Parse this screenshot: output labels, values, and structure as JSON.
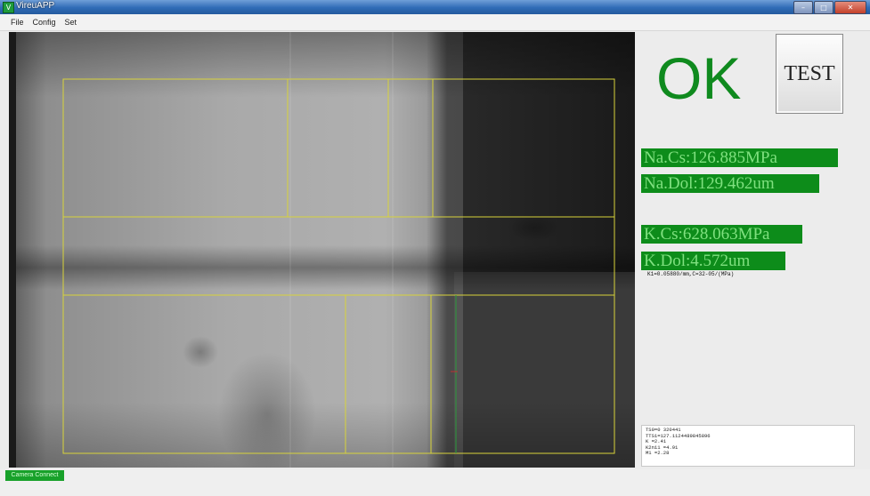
{
  "window": {
    "title": "VireuAPP",
    "icon": "app-icon"
  },
  "menu": {
    "items": [
      "File",
      "Config",
      "Set"
    ]
  },
  "result": {
    "status": "OK",
    "status_color": "#0f8a1e"
  },
  "test_button": {
    "label": "TEST"
  },
  "measurements": {
    "na_cs": "Na.Cs:126.885MPa",
    "na_dol": "Na.Dol:129.462um",
    "k_cs": "K.Cs:628.063MPa",
    "k_dol": "K.Dol:4.572um",
    "background_color": "#0d8c1a",
    "text_color": "#7fe07f"
  },
  "constants_note": "K1=0.05880/mm,C=32-05/(MPa)",
  "log": {
    "lines": [
      "TS0=0 320441",
      "TTS1=127.1124489845896",
      "K =2.41",
      "K2n11 =4.91",
      "M1 =2.28"
    ]
  },
  "status_bar": {
    "badge": "Camera Connect",
    "badge_color": "#18a12a"
  },
  "overlay": {
    "line_color": "#d8d33a",
    "marker_color": "#2a9a3a"
  }
}
